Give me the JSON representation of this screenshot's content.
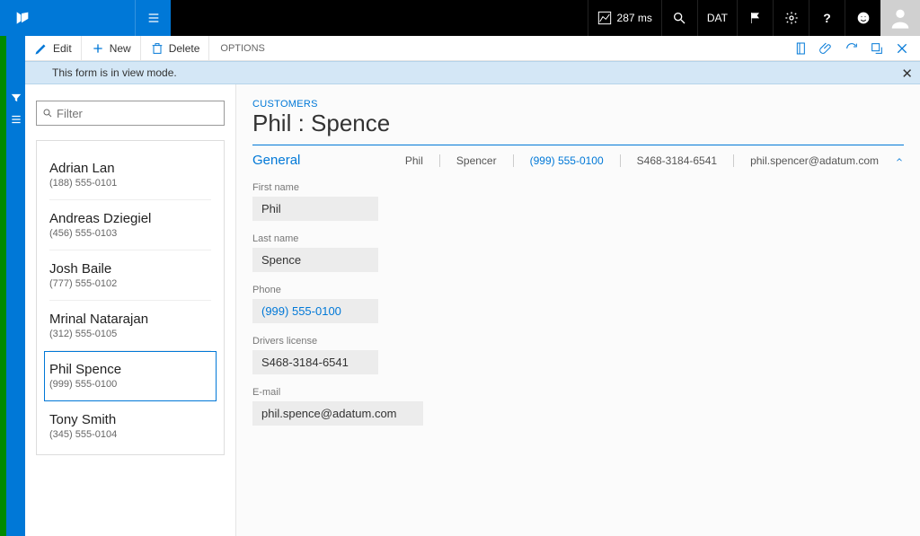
{
  "nav": {
    "perf_ms": "287 ms",
    "company": "DAT"
  },
  "cmd": {
    "edit": "Edit",
    "new": "New",
    "delete": "Delete",
    "options": "OPTIONS"
  },
  "message": "This form is in view mode.",
  "filter": {
    "placeholder": "Filter"
  },
  "customers": [
    {
      "name": "Adrian Lan",
      "phone": "(188) 555-0101"
    },
    {
      "name": "Andreas Dziegiel",
      "phone": "(456) 555-0103"
    },
    {
      "name": "Josh Baile",
      "phone": "(777) 555-0102"
    },
    {
      "name": "Mrinal Natarajan",
      "phone": "(312) 555-0105"
    },
    {
      "name": "Phil Spence",
      "phone": "(999) 555-0100"
    },
    {
      "name": "Tony Smith",
      "phone": "(345) 555-0104"
    }
  ],
  "detail": {
    "breadcrumb": "CUSTOMERS",
    "title": "Phil : Spence",
    "section": "General",
    "summary": {
      "first": "Phil",
      "last": "Spencer",
      "phone": "(999) 555-0100",
      "license": "S468-3184-6541",
      "email": "phil.spencer@adatum.com"
    },
    "fields": {
      "first_label": "First name",
      "first_value": "Phil",
      "last_label": "Last name",
      "last_value": "Spence",
      "phone_label": "Phone",
      "phone_value": "(999) 555-0100",
      "license_label": "Drivers license",
      "license_value": "S468-3184-6541",
      "email_label": "E-mail",
      "email_value": "phil.spence@adatum.com"
    }
  }
}
